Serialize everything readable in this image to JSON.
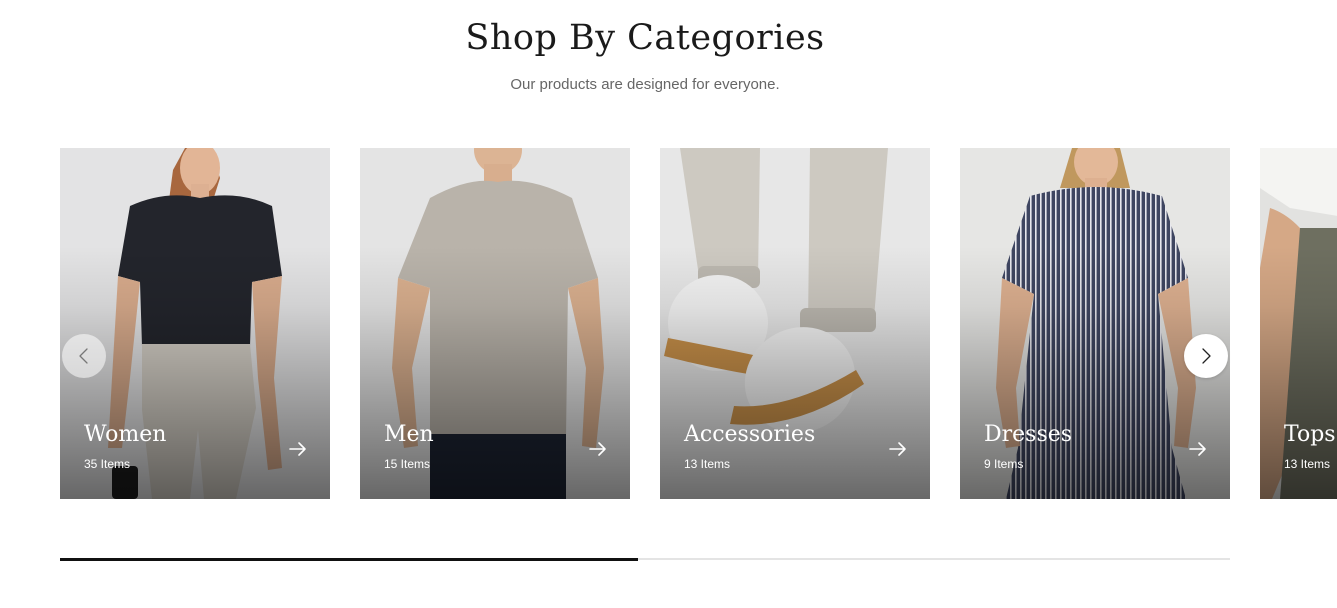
{
  "header": {
    "title": "Shop By Categories",
    "subtitle": "Our products are designed for everyone."
  },
  "categories": [
    {
      "name": "Women",
      "count": "35 Items"
    },
    {
      "name": "Men",
      "count": "15 Items"
    },
    {
      "name": "Accessories",
      "count": "13 Items"
    },
    {
      "name": "Dresses",
      "count": "9 Items"
    },
    {
      "name": "Tops",
      "count": "13 Items"
    }
  ],
  "carousel": {
    "progress": 0.494,
    "prev_icon": "chevron-left-icon",
    "next_icon": "chevron-right-icon",
    "card_icon": "arrow-right-icon"
  }
}
